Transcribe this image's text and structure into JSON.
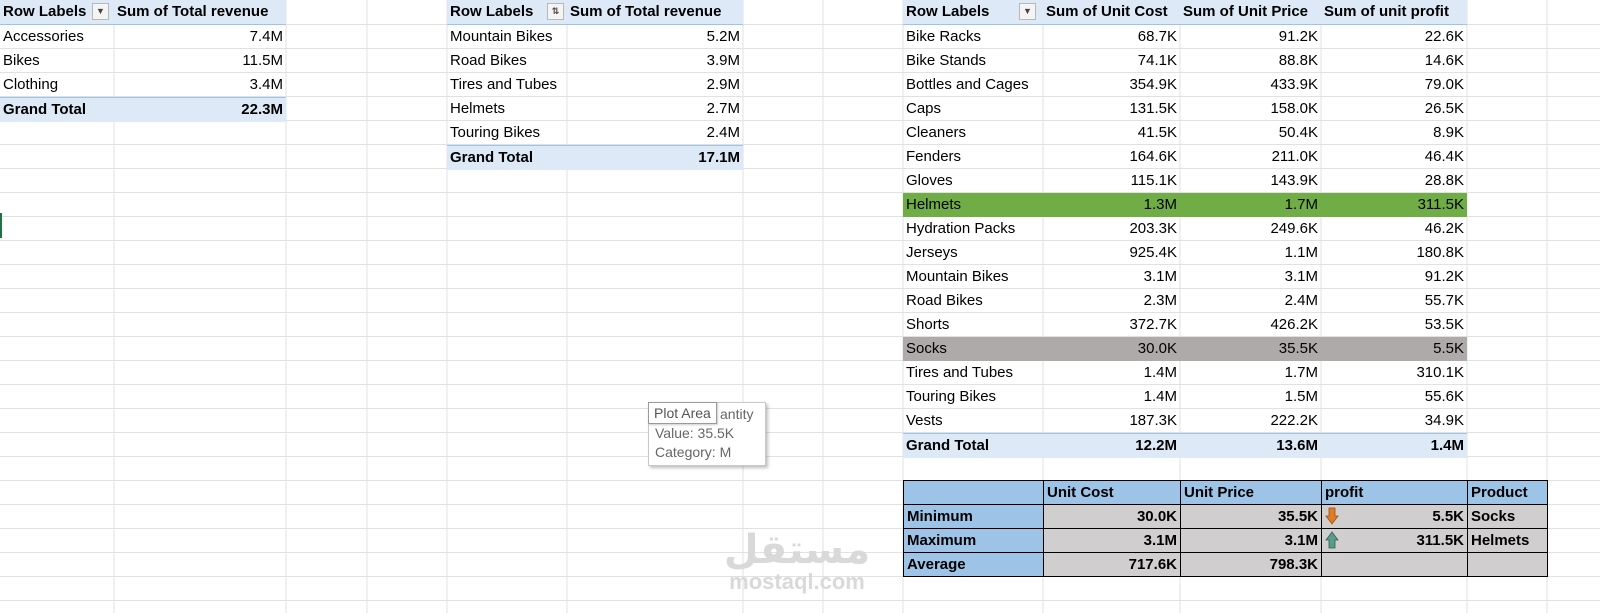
{
  "pivot1": {
    "headers": [
      "Row Labels",
      "Sum of Total revenue"
    ],
    "rows": [
      {
        "label": "Accessories",
        "value": "7.4M"
      },
      {
        "label": "Bikes",
        "value": "11.5M"
      },
      {
        "label": "Clothing",
        "value": "3.4M"
      }
    ],
    "total": {
      "label": "Grand Total",
      "value": "22.3M"
    }
  },
  "pivot2": {
    "headers": [
      "Row Labels",
      "Sum of Total revenue"
    ],
    "rows": [
      {
        "label": "Mountain Bikes",
        "value": "5.2M"
      },
      {
        "label": "Road Bikes",
        "value": "3.9M"
      },
      {
        "label": "Tires and Tubes",
        "value": "2.9M"
      },
      {
        "label": "Helmets",
        "value": "2.7M"
      },
      {
        "label": "Touring Bikes",
        "value": "2.4M"
      }
    ],
    "total": {
      "label": "Grand Total",
      "value": "17.1M"
    }
  },
  "pivot3": {
    "headers": [
      "Row Labels",
      "Sum of Unit Cost",
      "Sum of Unit Price",
      "Sum of unit profit"
    ],
    "rows": [
      {
        "label": "Bike Racks",
        "cost": "68.7K",
        "price": "91.2K",
        "profit": "22.6K"
      },
      {
        "label": "Bike Stands",
        "cost": "74.1K",
        "price": "88.8K",
        "profit": "14.6K"
      },
      {
        "label": "Bottles and Cages",
        "cost": "354.9K",
        "price": "433.9K",
        "profit": "79.0K"
      },
      {
        "label": "Caps",
        "cost": "131.5K",
        "price": "158.0K",
        "profit": "26.5K"
      },
      {
        "label": "Cleaners",
        "cost": "41.5K",
        "price": "50.4K",
        "profit": "8.9K"
      },
      {
        "label": "Fenders",
        "cost": "164.6K",
        "price": "211.0K",
        "profit": "46.4K"
      },
      {
        "label": "Gloves",
        "cost": "115.1K",
        "price": "143.9K",
        "profit": "28.8K"
      },
      {
        "label": "Helmets",
        "cost": "1.3M",
        "price": "1.7M",
        "profit": "311.5K",
        "highlight": "max"
      },
      {
        "label": "Hydration Packs",
        "cost": "203.3K",
        "price": "249.6K",
        "profit": "46.2K"
      },
      {
        "label": "Jerseys",
        "cost": "925.4K",
        "price": "1.1M",
        "profit": "180.8K"
      },
      {
        "label": "Mountain Bikes",
        "cost": "3.1M",
        "price": "3.1M",
        "profit": "91.2K"
      },
      {
        "label": "Road Bikes",
        "cost": "2.3M",
        "price": "2.4M",
        "profit": "55.7K"
      },
      {
        "label": "Shorts",
        "cost": "372.7K",
        "price": "426.2K",
        "profit": "53.5K"
      },
      {
        "label": "Socks",
        "cost": "30.0K",
        "price": "35.5K",
        "profit": "5.5K",
        "highlight": "min"
      },
      {
        "label": "Tires and Tubes",
        "cost": "1.4M",
        "price": "1.7M",
        "profit": "310.1K"
      },
      {
        "label": "Touring Bikes",
        "cost": "1.4M",
        "price": "1.5M",
        "profit": "55.6K"
      },
      {
        "label": "Vests",
        "cost": "187.3K",
        "price": "222.2K",
        "profit": "34.9K"
      }
    ],
    "total": {
      "label": "Grand Total",
      "cost": "12.2M",
      "price": "13.6M",
      "profit": "1.4M"
    }
  },
  "stats": {
    "headers": [
      "",
      "Unit Cost",
      "Unit Price",
      "profit",
      "Product"
    ],
    "rows": [
      {
        "label": "Minimum",
        "cost": "30.0K",
        "price": "35.5K",
        "profit": "5.5K",
        "product": "Socks",
        "icon": "arrow-down-icon"
      },
      {
        "label": "Maximum",
        "cost": "3.1M",
        "price": "3.1M",
        "profit": "311.5K",
        "product": "Helmets",
        "icon": "arrow-up-icon"
      },
      {
        "label": "Average",
        "cost": "717.6K",
        "price": "798.3K",
        "profit": "",
        "product": ""
      }
    ]
  },
  "tooltip": {
    "chip": "Plot Area",
    "line1_tail": "antity",
    "line2": "Value: 35.5K",
    "line3": "Category: M"
  },
  "watermark": {
    "arabic": "مستقل",
    "latin": "mostaql.com"
  },
  "colors": {
    "header_bg": "#dde9f6",
    "max_row": "#70ad47",
    "min_row": "#aeaaaa",
    "stats_header": "#9dc3e6",
    "stats_cell": "#d0cece",
    "arrow_down": "#e07b28",
    "arrow_up": "#5b9b8a"
  }
}
